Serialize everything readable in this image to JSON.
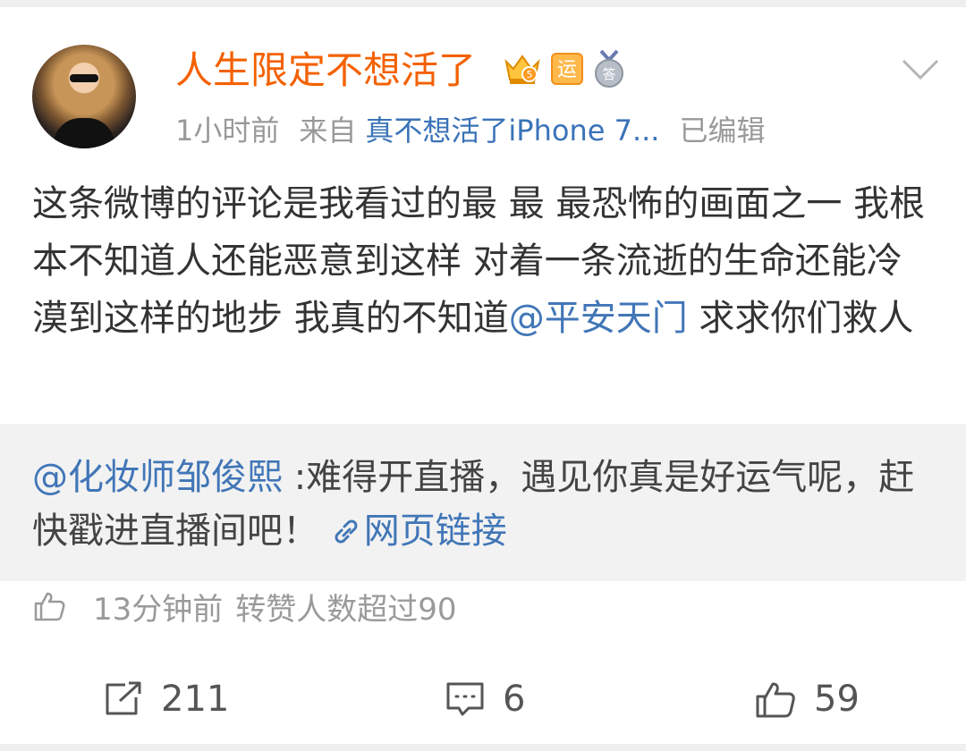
{
  "post": {
    "username": "人生限定不想活了",
    "badges": {
      "yun": "运",
      "da": "答"
    },
    "meta": {
      "time": "1小时前",
      "from_label": "来自",
      "source": "真不想活了iPhone 7...",
      "edited": "已编辑"
    },
    "body_pre": "这条微博的评论是我看过的最 最 最恐怖的画面之一 我根本不知道人还能恶意到这样 对着一条流逝的生命还能冷漠到这样的地步 我真的不知道",
    "body_mention": "@平安天门",
    "body_post": " 求求你们救人"
  },
  "repost": {
    "mention": "@化妆师邹俊熙",
    "text": " :难得开直播，遇见你真是好运气呢，赶快戳进直播间吧！ ",
    "link_label": "网页链接"
  },
  "likeline": {
    "time": "13分钟前",
    "text": "转赞人数超过90"
  },
  "actions": {
    "repost_count": "211",
    "comment_count": "6",
    "like_count": "59"
  },
  "colors": {
    "username": "#f46100",
    "link": "#4176b7",
    "muted": "#999999",
    "repost_bg": "#f2f2f2"
  }
}
